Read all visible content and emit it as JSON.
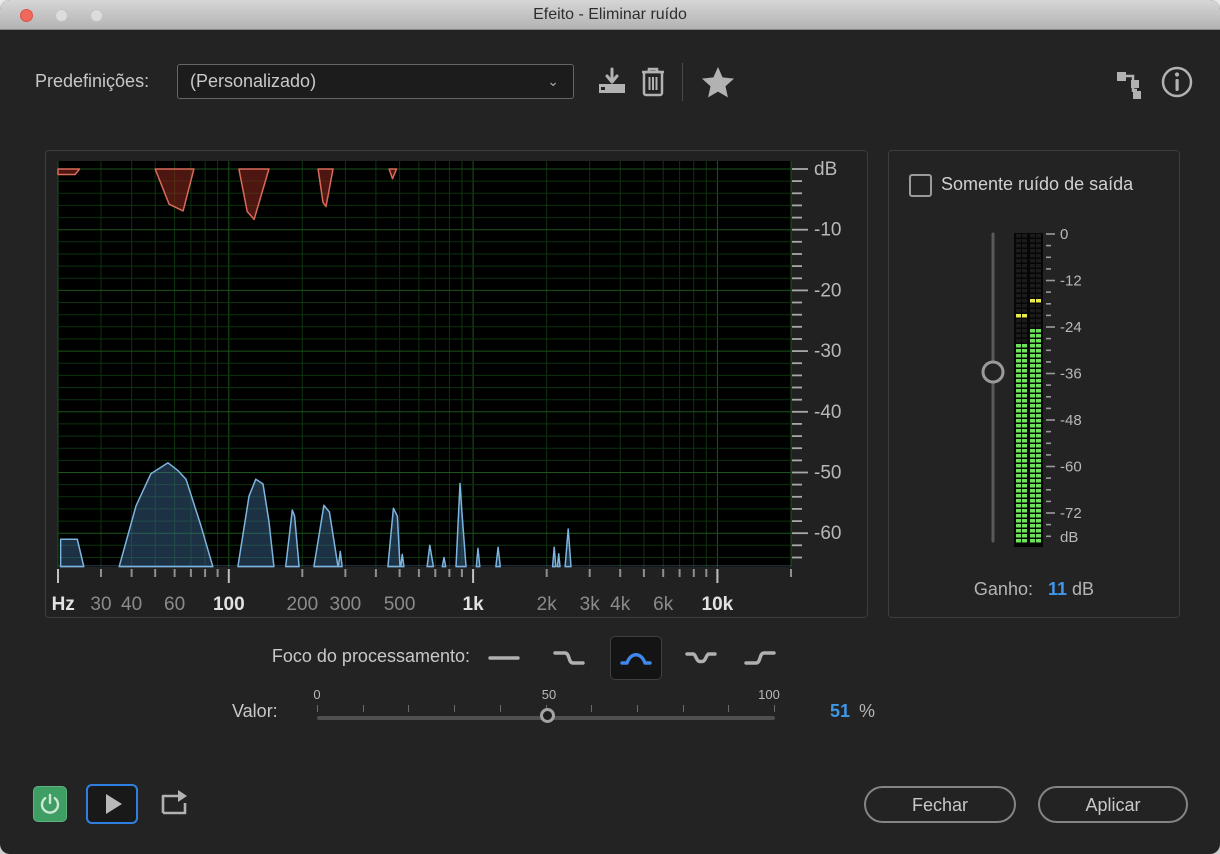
{
  "window": {
    "title": "Efeito - Eliminar ruído"
  },
  "toolbar": {
    "presets_label": "Predefinições:",
    "preset_value": "(Personalizado)",
    "icons": [
      "save-preset-icon",
      "delete-preset-icon",
      "favorite-star-icon",
      "channel-map-icon",
      "info-icon"
    ]
  },
  "chart_data": {
    "type": "area",
    "title": "",
    "x_axis": {
      "unit": "Hz",
      "scale": "log",
      "min": 20,
      "max": 20000,
      "labels": [
        {
          "text": "Hz",
          "freq": 21,
          "bright": true
        },
        {
          "text": "30",
          "freq": 30,
          "bright": false
        },
        {
          "text": "40",
          "freq": 40,
          "bright": false
        },
        {
          "text": "60",
          "freq": 60,
          "bright": false
        },
        {
          "text": "100",
          "freq": 100,
          "bright": true
        },
        {
          "text": "200",
          "freq": 200,
          "bright": false
        },
        {
          "text": "300",
          "freq": 300,
          "bright": false
        },
        {
          "text": "500",
          "freq": 500,
          "bright": false
        },
        {
          "text": "1k",
          "freq": 1000,
          "bright": true
        },
        {
          "text": "2k",
          "freq": 2000,
          "bright": false
        },
        {
          "text": "3k",
          "freq": 3000,
          "bright": false
        },
        {
          "text": "4k",
          "freq": 4000,
          "bright": false
        },
        {
          "text": "6k",
          "freq": 6000,
          "bright": false
        },
        {
          "text": "10k",
          "freq": 10000,
          "bright": true
        }
      ],
      "major_ticks": [
        20,
        100,
        1000,
        10000
      ],
      "minor_ticks": [
        30,
        40,
        50,
        60,
        70,
        80,
        90,
        200,
        300,
        400,
        500,
        600,
        700,
        800,
        900,
        2000,
        3000,
        4000,
        5000,
        6000,
        7000,
        8000,
        9000,
        20000
      ],
      "gridlines": [
        20,
        30,
        40,
        50,
        60,
        70,
        80,
        90,
        100,
        200,
        300,
        400,
        500,
        600,
        700,
        800,
        900,
        1000,
        2000,
        3000,
        4000,
        5000,
        6000,
        7000,
        8000,
        9000,
        10000,
        20000
      ],
      "emphasized_gridlines": [
        20,
        100,
        1000,
        10000,
        20000
      ]
    },
    "y_axis": {
      "unit": "dB",
      "max": 1.3,
      "min": -65.5,
      "major_step": 10,
      "minor_step": 2,
      "ruler_labels": [
        {
          "text": "dB",
          "db": 0
        },
        {
          "text": "-10",
          "db": -10
        },
        {
          "text": "-20",
          "db": -20
        },
        {
          "text": "-30",
          "db": -30
        },
        {
          "text": "-40",
          "db": -40
        },
        {
          "text": "-50",
          "db": -50
        },
        {
          "text": "-60",
          "db": -60
        }
      ]
    },
    "grid": {
      "dim": "#0d330d",
      "bright": "#1b551b"
    },
    "series": [
      {
        "name": "noise-profile",
        "anchor": "top",
        "stroke": "#d96a5a",
        "fill": "rgba(140,40,30,0.55)",
        "polygons": [
          [
            [
              20,
              0
            ],
            [
              20,
              -0.9
            ],
            [
              23.5,
              -0.9
            ],
            [
              24.5,
              0
            ]
          ],
          [
            [
              50,
              0
            ],
            [
              57,
              -5.8
            ],
            [
              65,
              -6.9
            ],
            [
              72,
              0
            ]
          ],
          [
            [
              110,
              0
            ],
            [
              119,
              -7.0
            ],
            [
              127,
              -8.3
            ],
            [
              146,
              0
            ]
          ],
          [
            [
              232,
              0
            ],
            [
              243,
              -5.5
            ],
            [
              250,
              -6.2
            ],
            [
              267,
              0
            ]
          ],
          [
            [
              453,
              0
            ],
            [
              468,
              -1.6
            ],
            [
              486,
              0
            ]
          ]
        ]
      },
      {
        "name": "signal-spectrum",
        "anchor": "bottom",
        "stroke": "#7db4e0",
        "fill": "rgba(62,108,150,0.45)",
        "polygons": [
          [
            [
              20.5,
              -65.5
            ],
            [
              20.5,
              -61
            ],
            [
              24,
              -61
            ],
            [
              25.5,
              -65.5
            ]
          ],
          [
            [
              35.6,
              -65.5
            ],
            [
              41.7,
              -55.5
            ],
            [
              48,
              -50.2
            ],
            [
              56.4,
              -48.4
            ],
            [
              62,
              -49.7
            ],
            [
              66.8,
              -51.1
            ],
            [
              77,
              -58.8
            ],
            [
              86,
              -65.5
            ]
          ],
          [
            [
              109,
              -65.5
            ],
            [
              121,
              -53.9
            ],
            [
              129,
              -51.1
            ],
            [
              138,
              -51.9
            ],
            [
              146,
              -58
            ],
            [
              153,
              -65.5
            ]
          ],
          [
            [
              171,
              -65.5
            ],
            [
              182,
              -56.2
            ],
            [
              186,
              -57.2
            ],
            [
              194,
              -65.5
            ]
          ],
          [
            [
              223,
              -65.5
            ],
            [
              245,
              -55.4
            ],
            [
              258,
              -56.5
            ],
            [
              280,
              -65.5
            ]
          ],
          [
            [
              281,
              -65.5
            ],
            [
              286,
              -63
            ],
            [
              291,
              -65.5
            ]
          ],
          [
            [
              448,
              -65.5
            ],
            [
              472,
              -55.9
            ],
            [
              490,
              -57.2
            ],
            [
              502,
              -65.5
            ]
          ],
          [
            [
              506,
              -65.5
            ],
            [
              513,
              -63.5
            ],
            [
              521,
              -65.5
            ]
          ],
          [
            [
              648,
              -65.5
            ],
            [
              665,
              -62
            ],
            [
              688,
              -65.5
            ]
          ],
          [
            [
              748,
              -65.5
            ],
            [
              760,
              -64
            ],
            [
              772,
              -65.5
            ]
          ],
          [
            [
              851,
              -65.5
            ],
            [
              884,
              -51.8
            ],
            [
              900,
              -56.5
            ],
            [
              935,
              -65.5
            ]
          ],
          [
            [
              1030,
              -65.5
            ],
            [
              1047,
              -62.5
            ],
            [
              1065,
              -65.5
            ]
          ],
          [
            [
              1240,
              -65.5
            ],
            [
              1265,
              -62.3
            ],
            [
              1292,
              -65.5
            ]
          ],
          [
            [
              2115,
              -65.5
            ],
            [
              2148,
              -62.3
            ],
            [
              2180,
              -65.5
            ]
          ],
          [
            [
              2212,
              -65.5
            ],
            [
              2240,
              -63.4
            ],
            [
              2268,
              -65.5
            ]
          ],
          [
            [
              2380,
              -65.5
            ],
            [
              2450,
              -59.3
            ],
            [
              2515,
              -65.5
            ]
          ]
        ]
      }
    ]
  },
  "output_panel": {
    "only_noise_label": "Somente ruído de saída",
    "only_noise_checked": false,
    "meter": {
      "scale_labels": [
        "0",
        "-12",
        "-24",
        "-36",
        "-48",
        "-60",
        "-72"
      ],
      "bottom_label": "dB",
      "channels": [
        {
          "level_db": -28,
          "peak_db": -21
        },
        {
          "level_db": -24,
          "peak_db": -17
        }
      ]
    },
    "gain_label": "Ganho:",
    "gain_value": "11",
    "gain_unit": "dB",
    "gain_slider_fraction": 0.45
  },
  "processing_focus": {
    "label": "Foco do processamento:",
    "selected_index": 2,
    "options": [
      "full-range",
      "focus-low",
      "focus-mid",
      "focus-extremes",
      "focus-high"
    ]
  },
  "valor": {
    "label": "Valor:",
    "scale_labels": [
      "0",
      "50",
      "100"
    ],
    "value": 51,
    "value_text": "51",
    "unit": "%"
  },
  "footer": {
    "close": "Fechar",
    "apply": "Aplicar"
  },
  "colors": {
    "accent_blue": "#3f97e8",
    "meter_green": "#6ee25a",
    "meter_peak_yellow": "#e9ec4f",
    "noise_red": "#d96a5a",
    "signal_blue": "#7db4e0",
    "power_green": "#3f9e63",
    "play_border_blue": "#2f7fe0",
    "selected_icon_blue": "#3f87e8"
  }
}
